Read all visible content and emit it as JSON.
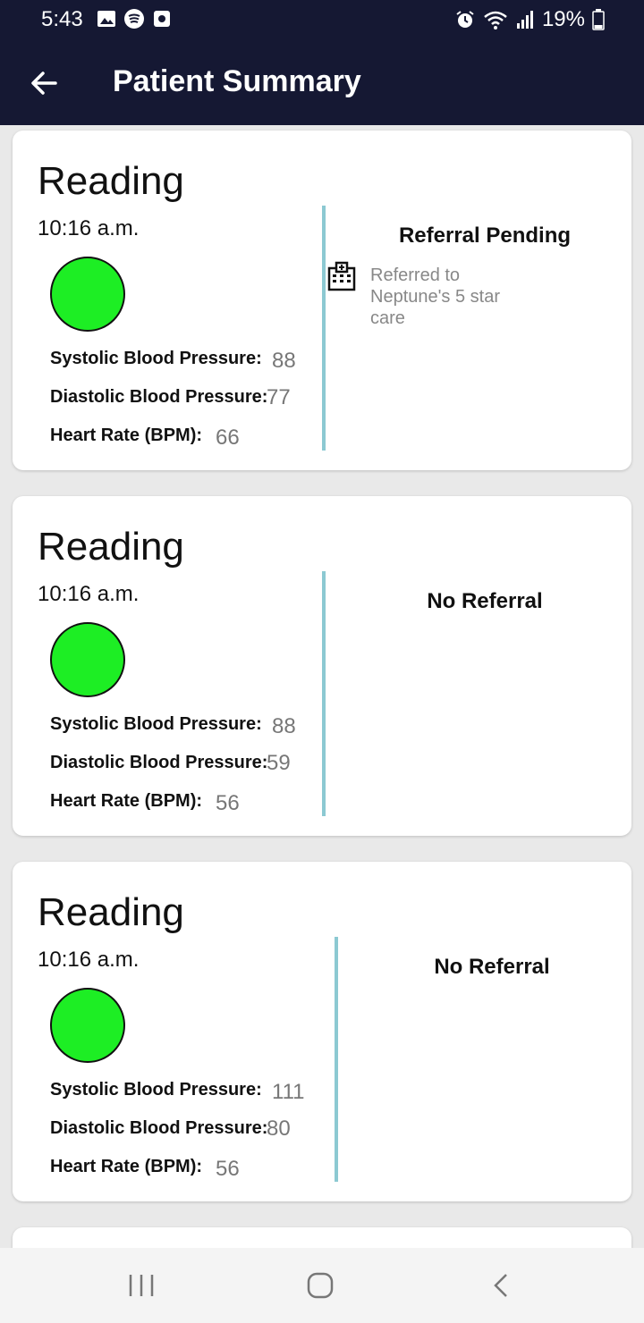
{
  "status_bar": {
    "time": "5:43",
    "battery": "19%"
  },
  "app_bar": {
    "title": "Patient Summary"
  },
  "readings": [
    {
      "heading": "Reading",
      "time": "10:16 a.m.",
      "status_color": "#1dee24",
      "rows": [
        {
          "label": "Systolic Blood Pressure:",
          "value": "88"
        },
        {
          "label": "Diastolic Blood Pressure:",
          "value": "77"
        },
        {
          "label": "Heart Rate (BPM):",
          "value": "66"
        }
      ],
      "referral_title": "Referral Pending",
      "referral_text": "Referred to Neptune's 5 star care"
    },
    {
      "heading": "Reading",
      "time": "10:16 a.m.",
      "status_color": "#1dee24",
      "rows": [
        {
          "label": "Systolic Blood Pressure:",
          "value": "88"
        },
        {
          "label": "Diastolic Blood Pressure:",
          "value": "59"
        },
        {
          "label": "Heart Rate (BPM):",
          "value": "56"
        }
      ],
      "referral_title": "No Referral"
    },
    {
      "heading": "Reading",
      "time": "10:16 a.m.",
      "status_color": "#1dee24",
      "rows": [
        {
          "label": "Systolic Blood Pressure:",
          "value": "111"
        },
        {
          "label": "Diastolic Blood Pressure:",
          "value": "80"
        },
        {
          "label": "Heart Rate (BPM):",
          "value": "56"
        }
      ],
      "referral_title": "No Referral"
    }
  ],
  "icons": {
    "back": "arrow-left-icon",
    "hospital": "hospital-icon",
    "nav_recents": "recents-icon",
    "nav_home": "home-icon",
    "nav_back": "chevron-left-icon"
  },
  "colors": {
    "app_bar": "#151833",
    "divider": "#8cc9d2",
    "status_green": "#1dee24"
  }
}
